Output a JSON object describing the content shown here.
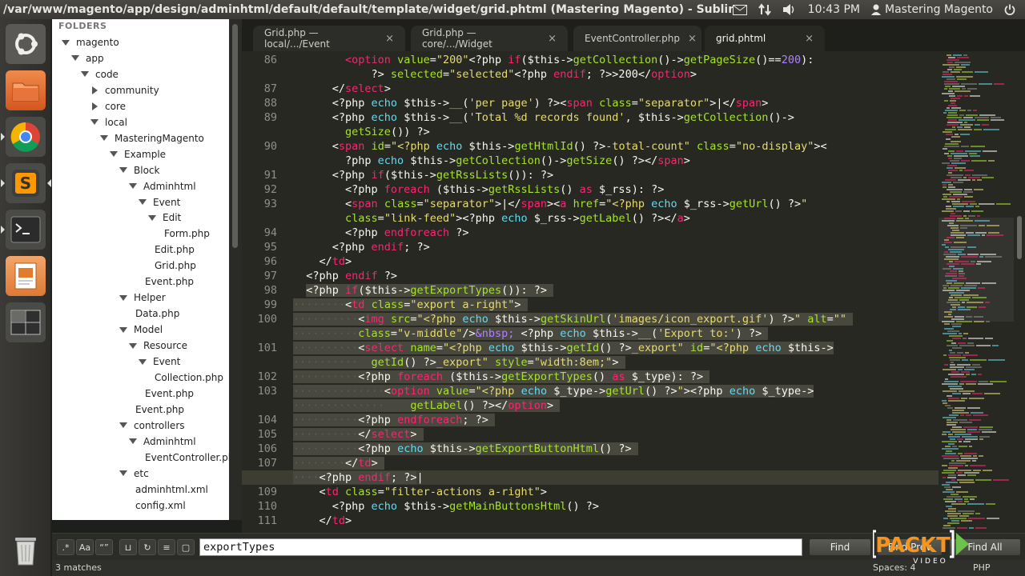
{
  "window": {
    "title": "/var/www/magento/app/design/adminhtml/default/default/template/widget/grid.phtml (Mastering Magento) - Sublime Text 2",
    "clock": "10:43 PM",
    "user": "Mastering Magento"
  },
  "sidebar": {
    "header": "FOLDERS",
    "items": [
      {
        "label": "magento",
        "depth": 0,
        "state": "open"
      },
      {
        "label": "app",
        "depth": 1,
        "state": "open"
      },
      {
        "label": "code",
        "depth": 2,
        "state": "open"
      },
      {
        "label": "community",
        "depth": 3,
        "state": "closed"
      },
      {
        "label": "core",
        "depth": 3,
        "state": "closed"
      },
      {
        "label": "local",
        "depth": 3,
        "state": "open"
      },
      {
        "label": "MasteringMagento",
        "depth": 4,
        "state": "open"
      },
      {
        "label": "Example",
        "depth": 5,
        "state": "open"
      },
      {
        "label": "Block",
        "depth": 6,
        "state": "open"
      },
      {
        "label": "Adminhtml",
        "depth": 7,
        "state": "open"
      },
      {
        "label": "Event",
        "depth": 8,
        "state": "open"
      },
      {
        "label": "Edit",
        "depth": 9,
        "state": "open"
      },
      {
        "label": "Form.php",
        "depth": 10,
        "state": "file"
      },
      {
        "label": "Edit.php",
        "depth": 9,
        "state": "file"
      },
      {
        "label": "Grid.php",
        "depth": 9,
        "state": "file"
      },
      {
        "label": "Event.php",
        "depth": 8,
        "state": "file"
      },
      {
        "label": "Helper",
        "depth": 6,
        "state": "open"
      },
      {
        "label": "Data.php",
        "depth": 7,
        "state": "file"
      },
      {
        "label": "Model",
        "depth": 6,
        "state": "open"
      },
      {
        "label": "Resource",
        "depth": 7,
        "state": "open"
      },
      {
        "label": "Event",
        "depth": 8,
        "state": "open"
      },
      {
        "label": "Collection.php",
        "depth": 9,
        "state": "file"
      },
      {
        "label": "Event.php",
        "depth": 8,
        "state": "file"
      },
      {
        "label": "Event.php",
        "depth": 7,
        "state": "file"
      },
      {
        "label": "controllers",
        "depth": 6,
        "state": "open"
      },
      {
        "label": "Adminhtml",
        "depth": 7,
        "state": "open"
      },
      {
        "label": "EventController.php",
        "depth": 8,
        "state": "file"
      },
      {
        "label": "etc",
        "depth": 6,
        "state": "open"
      },
      {
        "label": "adminhtml.xml",
        "depth": 7,
        "state": "file"
      },
      {
        "label": "config.xml",
        "depth": 7,
        "state": "file"
      }
    ]
  },
  "tabs": [
    {
      "label": "Grid.php — local/.../Event",
      "active": false
    },
    {
      "label": "Grid.php — core/.../Widget",
      "active": false
    },
    {
      "label": "EventController.php",
      "active": false
    },
    {
      "label": "grid.phtml",
      "active": true
    }
  ],
  "editor": {
    "current_line": "108",
    "lines": [
      {
        "n": "86",
        "h": "        <t>&lt;option</t> <a>value</a>=<s>\"200\"</s>&lt;?php <t>if</t>($this-&gt;<a>getCollection</a>()-&gt;<a>getPageSize</a>()==<c>200</c>):"
      },
      {
        "n": "",
        "h": "            ?&gt; <a>selected</a>=<s>\"selected\"</s>&lt;?php <t>endif</t>; ?&gt;&gt;200&lt;/<t>option</t>&gt;"
      },
      {
        "n": "87",
        "h": "      &lt;/<t>select</t>&gt;"
      },
      {
        "n": "88",
        "h": "      &lt;?php <k>echo</k> $this-&gt;<a>__</a>(<s>'per page'</s>) ?&gt;&lt;<t>span</t> <a>class</a>=<s>\"separator\"</s>&gt;|&lt;/<t>span</t>&gt;"
      },
      {
        "n": "89",
        "h": "      &lt;?php <k>echo</k> $this-&gt;<a>__</a>(<s>'Total %d records found'</s>, $this-&gt;<a>getCollection</a>()-&gt;"
      },
      {
        "n": "",
        "h": "        <a>getSize</a>()) ?&gt;"
      },
      {
        "n": "90",
        "h": "      &lt;<t>span</t> <a>id</a>=<s>\"&lt;?php</s> <k>echo</k> $this-&gt;<a>getHtmlId</a>() ?&gt;<s>-total-count\"</s> <a>class</a>=<s>\"no-display\"</s>&gt;&lt;"
      },
      {
        "n": "",
        "h": "        ?php <k>echo</k> $this-&gt;<a>getCollection</a>()-&gt;<a>getSize</a>() ?&gt;&lt;/<t>span</t>&gt;"
      },
      {
        "n": "91",
        "h": "      &lt;?php <t>if</t>($this-&gt;<a>getRssLists</a>()): ?&gt;"
      },
      {
        "n": "92",
        "h": "        &lt;?php <t>foreach</t> ($this-&gt;<a>getRssLists</a>() <t>as</t> $_rss): ?&gt;"
      },
      {
        "n": "93",
        "h": "        &lt;<t>span</t> <a>class</a>=<s>\"separator\"</s>&gt;|&lt;/<t>span</t>&gt;&lt;<t>a</t> <a>href</a>=<s>\"&lt;?php</s> <k>echo</k> $_rss-&gt;<a>getUrl</a>() ?&gt;<s>\"</s>"
      },
      {
        "n": "",
        "h": "        <a>class</a>=<s>\"link-feed\"</s>&gt;&lt;?php <k>echo</k> $_rss-&gt;<a>getLabel</a>() ?&gt;&lt;/<t>a</t>&gt;"
      },
      {
        "n": "94",
        "h": "        &lt;?php <t>endforeach</t> ?&gt;"
      },
      {
        "n": "95",
        "h": "      &lt;?php <t>endif</t>; ?&gt;"
      },
      {
        "n": "96",
        "h": "    &lt;/<t>td</t>&gt;"
      },
      {
        "n": "97",
        "h": "  &lt;?php <t>endif</t> ?&gt;"
      },
      {
        "n": "98",
        "h": "  <span class=\"sel\">&lt;?php <t>if</t>($this-&gt;<a>getExportTypes</a>()): ?&gt; </span>"
      },
      {
        "n": "99",
        "h": "<span class=\"sel\"><w>········</w>&lt;<t>td</t> <a>class</a>=<s>\"export a-right\"</s>&gt; </span>"
      },
      {
        "n": "100",
        "h": "<span class=\"sel\"><w>··········</w>&lt;<t>img</t> <a>src</a>=<s>\"&lt;?php</s> <k>echo</k> $this-&gt;<a>getSkinUrl</a>(<s>'images/icon_export.gif'</s>) ?&gt;<s>\"</s> <a>alt</a>=<s>\"\"</s> </span>"
      },
      {
        "n": "",
        "h": "<span class=\"sel\"><w>··········</w><a>class</a>=<s>\"v-middle\"</s>/&gt;<c>&amp;nbsp;</c> &lt;?php <k>echo</k> $this-&gt;<a>__</a>(<s>'Export to:'</s>) ?&gt; </span>"
      },
      {
        "n": "101",
        "h": "<span class=\"sel\"><w>··········</w>&lt;<t>select</t> <a>name</a>=<s>\"&lt;?php</s> <k>echo</k> $this-&gt;<a>getId</a>() ?&gt;<s>_export\"</s> <a>id</a>=<s>\"&lt;?php</s> <k>echo</k> $this-&gt;</span>"
      },
      {
        "n": "",
        "h": "<span class=\"sel\"><w>··········</w>  <a>getId</a>() ?&gt;<s>_export\"</s> <a>style</a>=<s>\"width:8em;\"</s>&gt; </span>"
      },
      {
        "n": "102",
        "h": "<span class=\"sel\"><w>··········</w>&lt;?php <t>foreach</t> ($this-&gt;<a>getExportTypes</a>() <t>as</t> $_type): ?&gt; </span>"
      },
      {
        "n": "103",
        "h": "<span class=\"sel\"><w>··············</w>&lt;<t>option</t> <a>value</a>=<s>\"&lt;?php</s> <k>echo</k> $_type-&gt;<a>getUrl</a>() ?&gt;<s>\"</s>&gt;&lt;?php <k>echo</k> $_type-&gt;</span>"
      },
      {
        "n": "",
        "h": "<span class=\"sel\"><w>··············</w>    <a>getLabel</a>() ?&gt;&lt;/<t>option</t>&gt; </span>"
      },
      {
        "n": "104",
        "h": "<span class=\"sel\"><w>··········</w>&lt;?php <t>endforeach</t>; ?&gt; </span>"
      },
      {
        "n": "105",
        "h": "<span class=\"sel\"><w>··········</w>&lt;/<t>select</t>&gt; </span>"
      },
      {
        "n": "106",
        "h": "<span class=\"sel\"><w>··········</w>&lt;?php <k>echo</k> $this-&gt;<a>getExportButtonHtml</a>() ?&gt; </span>"
      },
      {
        "n": "107",
        "h": "<span class=\"sel\"><w>········</w>&lt;/<t>td</t>&gt; </span>"
      },
      {
        "n": "108",
        "h": "<span class=\"sel\"><w>····</w>&lt;?php <t>endif</t>; ?&gt;</span>|"
      },
      {
        "n": "109",
        "h": "    &lt;<t>td</t> <a>class</a>=<s>\"filter-actions a-right\"</s>&gt;"
      },
      {
        "n": "110",
        "h": "      &lt;?php <k>echo</k> $this-&gt;<a>getMainButtonsHtml</a>() ?&gt;"
      },
      {
        "n": "111",
        "h": "    &lt;/<t>td</t>&gt;"
      }
    ]
  },
  "find": {
    "value": "exportTypes",
    "find_label": "Find",
    "find_prev_label": "Find Prev",
    "find_all_label": "Find All"
  },
  "status": {
    "matches": "3 matches",
    "spaces": "Spaces: 4",
    "syntax": "PHP"
  },
  "brand": {
    "name": "PACKT",
    "sub": "VIDEO"
  },
  "colors": {
    "tag": "#f92672",
    "string": "#e6db74",
    "attribute": "#a6e22e",
    "keyword": "#66d9ef",
    "background": "#272822",
    "selection": "#49483e"
  }
}
